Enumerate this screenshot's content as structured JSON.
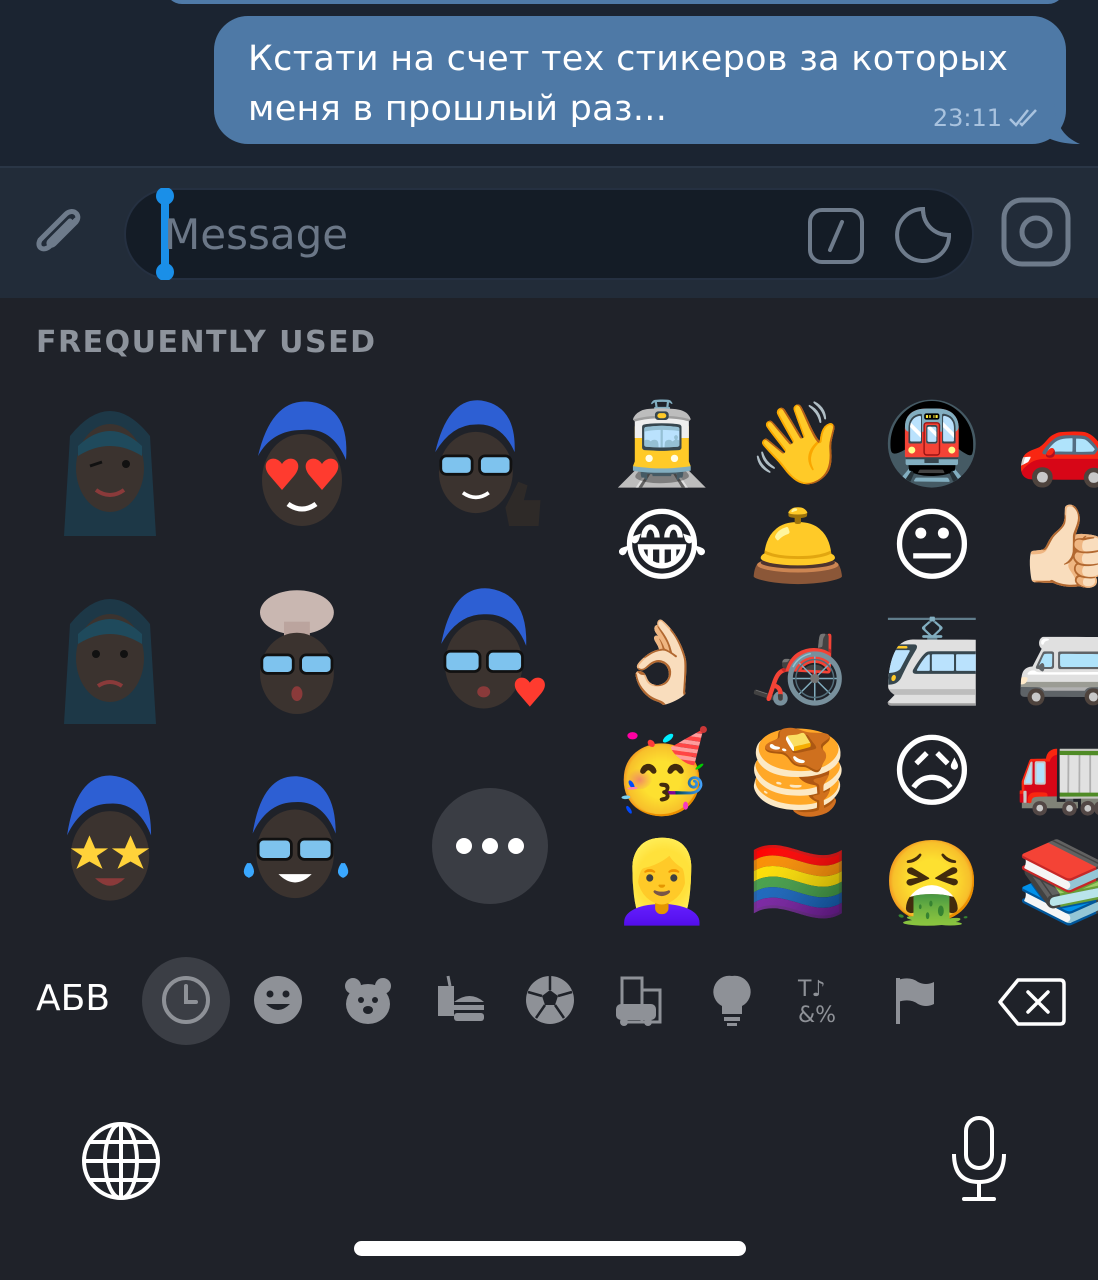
{
  "chat": {
    "message_text": "Кстати на счет тех стикеров за которых меня в прошлый раз...",
    "message_time": "23:11",
    "status_icon": "double-check-icon"
  },
  "input": {
    "placeholder": "Message",
    "value": "",
    "icons": [
      "paperclip-icon",
      "slash-command-icon",
      "sticker-icon",
      "camera-icon"
    ]
  },
  "keyboard": {
    "section_title": "FREQUENTLY USED",
    "memoji": [
      "memoji-wink",
      "memoji-heart-eyes",
      "memoji-thumbs-up",
      "memoji-sad",
      "memoji-mind-blown",
      "memoji-kiss",
      "memoji-star-struck",
      "memoji-tears-of-joy",
      "more"
    ],
    "emoji_rows": [
      [
        "🚊",
        "👋",
        "🚇",
        "🚗"
      ],
      [
        "😂",
        "🛎️",
        "😐",
        "👍🏻"
      ],
      [
        "👌🏻",
        "🦽",
        "🚈",
        "🚐"
      ],
      [
        "🥳",
        "🥞",
        "😥",
        "🚛"
      ],
      [
        "👱‍♀️",
        "🏳️‍🌈",
        "🤮",
        "📚"
      ]
    ],
    "abc_label": "АБВ",
    "categories": [
      "recent-clock-icon",
      "smiley-icon",
      "bear-icon",
      "food-icon",
      "soccer-ball-icon",
      "buildings-icon",
      "lightbulb-icon",
      "symbols-icon",
      "flag-icon"
    ],
    "active_category": "recent-clock-icon"
  },
  "colors": {
    "chat_bg": "#1b2431",
    "bubble": "#4e79a6",
    "keyboard_bg": "#1f2229",
    "cursor": "#1a8fe8"
  }
}
